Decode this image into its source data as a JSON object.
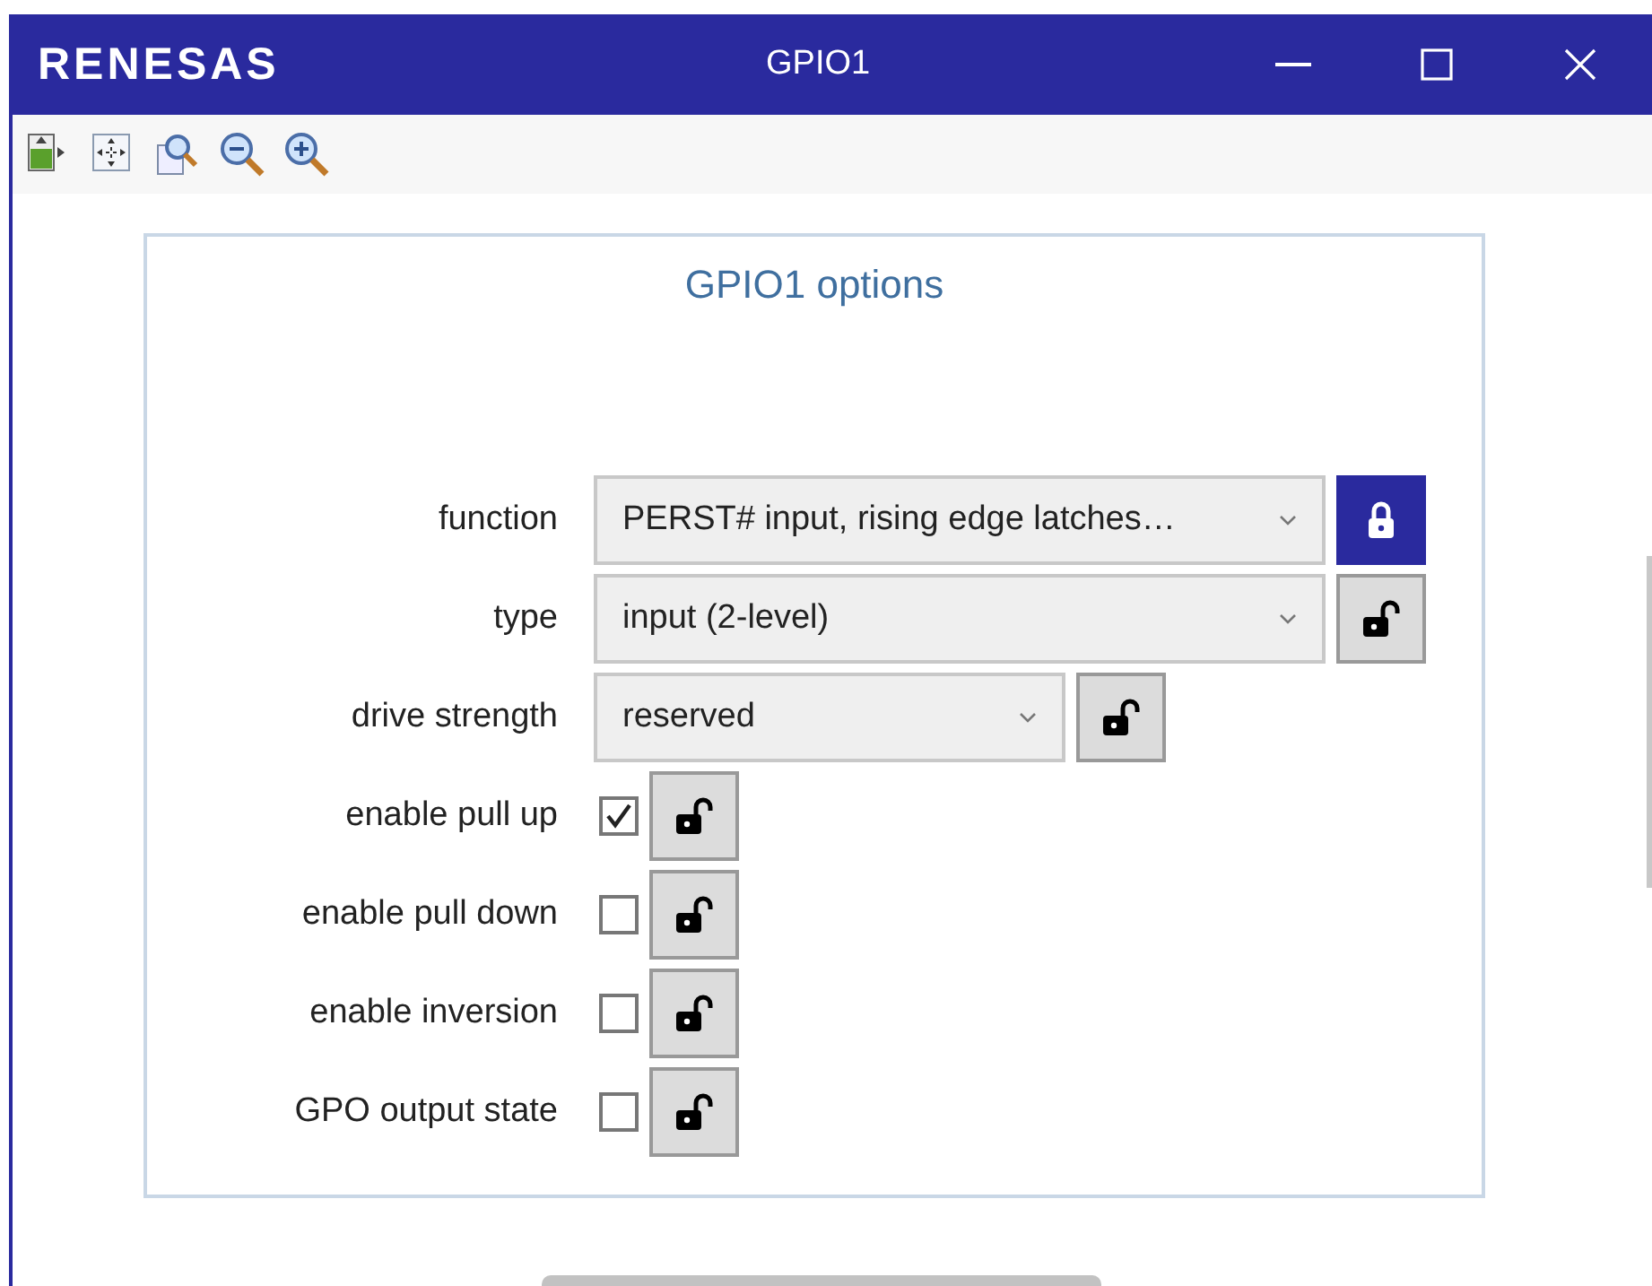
{
  "window": {
    "logo": "RENESAS",
    "title": "GPIO1"
  },
  "panel": {
    "title": "GPIO1 options",
    "rows": [
      {
        "kind": "dropdown",
        "label": "function",
        "value": "PERST# input, rising edge latches…",
        "wide": true,
        "locked": true
      },
      {
        "kind": "dropdown",
        "label": "type",
        "value": "input (2-level)",
        "wide": true,
        "locked": false
      },
      {
        "kind": "dropdown",
        "label": "drive strength",
        "value": "reserved",
        "wide": false,
        "locked": false
      },
      {
        "kind": "checkbox",
        "label": "enable pull up",
        "checked": true,
        "locked": false
      },
      {
        "kind": "checkbox",
        "label": "enable pull down",
        "checked": false,
        "locked": false
      },
      {
        "kind": "checkbox",
        "label": "enable inversion",
        "checked": false,
        "locked": false
      },
      {
        "kind": "checkbox",
        "label": "GPO output state",
        "checked": false,
        "locked": false
      }
    ]
  }
}
